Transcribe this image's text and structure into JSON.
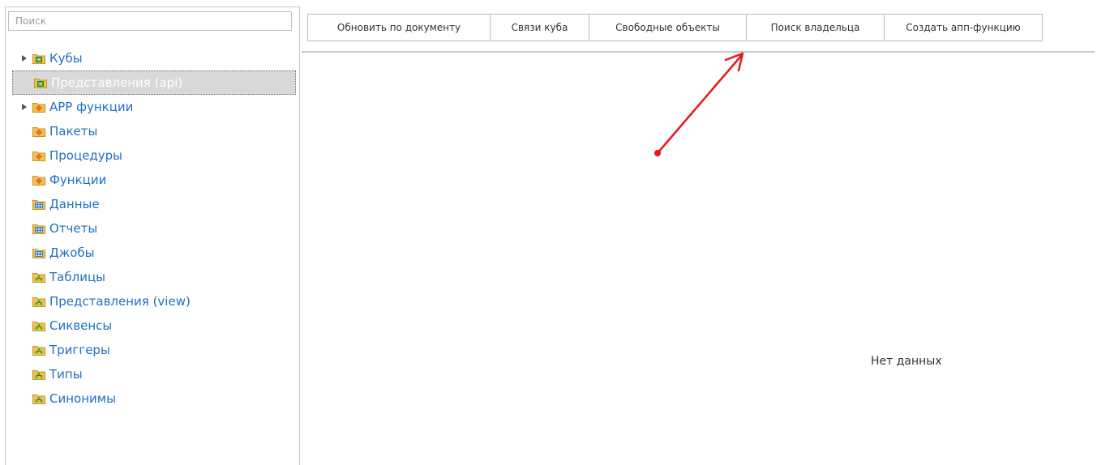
{
  "search": {
    "placeholder": "Поиск",
    "value": ""
  },
  "tree": {
    "items": [
      {
        "label": "Кубы",
        "icon": "folder-green-cube-icon",
        "expandable": true,
        "selected": false
      },
      {
        "label": "Представления (api)",
        "icon": "folder-green-cube-icon",
        "expandable": false,
        "selected": true
      },
      {
        "label": "APP функции",
        "icon": "folder-orange-function-icon",
        "expandable": true,
        "selected": false
      },
      {
        "label": "Пакеты",
        "icon": "folder-orange-function-icon",
        "expandable": false,
        "selected": false
      },
      {
        "label": "Процедуры",
        "icon": "folder-orange-function-icon",
        "expandable": false,
        "selected": false
      },
      {
        "label": "Функции",
        "icon": "folder-orange-function-icon",
        "expandable": false,
        "selected": false
      },
      {
        "label": "Данные",
        "icon": "folder-blue-grid-icon",
        "expandable": false,
        "selected": false
      },
      {
        "label": "Отчеты",
        "icon": "folder-blue-grid-icon",
        "expandable": false,
        "selected": false
      },
      {
        "label": "Джобы",
        "icon": "folder-blue-grid-icon",
        "expandable": false,
        "selected": false
      },
      {
        "label": "Таблицы",
        "icon": "folder-green-tree-icon",
        "expandable": false,
        "selected": false
      },
      {
        "label": "Представления (view)",
        "icon": "folder-green-tree-icon",
        "expandable": false,
        "selected": false
      },
      {
        "label": "Сиквенсы",
        "icon": "folder-green-tree-icon",
        "expandable": false,
        "selected": false
      },
      {
        "label": "Триггеры",
        "icon": "folder-green-tree-icon",
        "expandable": false,
        "selected": false
      },
      {
        "label": "Типы",
        "icon": "folder-green-tree-icon",
        "expandable": false,
        "selected": false
      },
      {
        "label": "Синонимы",
        "icon": "folder-green-tree-icon",
        "expandable": false,
        "selected": false
      }
    ]
  },
  "toolbar": {
    "update_by_document": "Обновить по документу",
    "cube_links": "Связи куба",
    "free_objects": "Свободные объекты",
    "find_owner": "Поиск владельца",
    "create_app_function": "Создать апп-функцию"
  },
  "content": {
    "empty_text": "Нет данных"
  },
  "colors": {
    "link_blue": "#1e6fc6",
    "selected_bg": "#d9d9d9",
    "annotation_red": "#e8161b",
    "folder_yellow": "#f4c14a",
    "icon_green": "#4caf50",
    "icon_orange": "#e8702a",
    "icon_blue": "#2f7cc9"
  }
}
